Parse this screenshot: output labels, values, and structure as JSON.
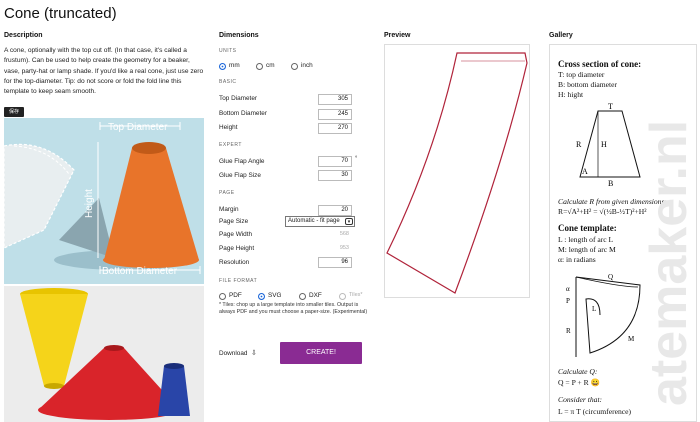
{
  "page": {
    "title": "Cone (truncated)"
  },
  "description": {
    "heading": "Description",
    "text": "A cone, optionally with the top cut off. (In that case, it's called a frustum). Can be used to help create the geometry for a beaker, vase, party-hat or lamp shade. If you'd like a real cone, just use zero for the top-diameter. Tip: do not score or fold the fold line this template to keep seam smooth.",
    "save_badge": "保存",
    "illustration_labels": {
      "top": "Top Diameter",
      "height": "Height",
      "bottom": "Bottom Diameter"
    }
  },
  "dimensions": {
    "heading": "Dimensions",
    "units": {
      "caption": "UNITS",
      "options": [
        "mm",
        "cm",
        "inch"
      ],
      "selected": "mm"
    },
    "basic": {
      "caption": "BASIC",
      "top_diameter": {
        "label": "Top Diameter",
        "value": "305"
      },
      "bottom_diameter": {
        "label": "Bottom Diameter",
        "value": "245"
      },
      "height": {
        "label": "Height",
        "value": "270"
      }
    },
    "expert": {
      "caption": "EXPERT",
      "glue_flap_angle": {
        "label": "Glue Flap Angle",
        "value": "70",
        "unit": "°"
      },
      "glue_flap_size": {
        "label": "Glue Flap Size",
        "value": "30"
      }
    },
    "page": {
      "caption": "PAGE",
      "margin": {
        "label": "Margin",
        "value": "20"
      },
      "page_size": {
        "label": "Page Size",
        "value": "Automatic - fit page"
      },
      "page_width": {
        "label": "Page Width",
        "value": "568"
      },
      "page_height": {
        "label": "Page Height",
        "value": "953"
      },
      "resolution": {
        "label": "Resolution",
        "value": "96"
      }
    },
    "file_format": {
      "caption": "FILE FORMAT",
      "options": [
        "PDF",
        "SVG",
        "DXF",
        "Tiles*"
      ],
      "selected": "SVG",
      "note": "* Tiles: chop up a large template into smaller tiles. Output is always PDF and you must choose a paper-size. (Experimental)"
    },
    "download_label": "Download",
    "create_label": "CREATE!"
  },
  "preview": {
    "heading": "Preview"
  },
  "gallery": {
    "heading": "Gallery",
    "cross_section_title": "Cross section of cone:",
    "legend": [
      "T: top diameter",
      "B: bottom diameter",
      "H: hight"
    ],
    "diagram1_labels": {
      "T": "T",
      "R": "R",
      "H": "H",
      "A": "A",
      "B": "B"
    },
    "calc_r": "Calculate R from given dimensions:",
    "formula_r": "R=√A²+H² = √(½B-½T)²+H²",
    "template_title": "Cone template:",
    "template_legend": [
      "L : length of arc L",
      "M: length of arc M",
      "α: in radians"
    ],
    "diagram2_labels": {
      "alpha": "α",
      "P": "P",
      "Q": "Q",
      "L": "L",
      "R": "R",
      "M": "M"
    },
    "calc_q": "Calculate Q:",
    "formula_q": "Q = P + R 😀",
    "consider": "Consider that:",
    "formula_l": "L = π T (circumference)",
    "watermark": "atemaker.nl"
  },
  "colors": {
    "accent": "#8a2b93",
    "cone_orange": "#e8742a",
    "template_line": "#b0233a",
    "radio_selected": "#1a66d9"
  }
}
